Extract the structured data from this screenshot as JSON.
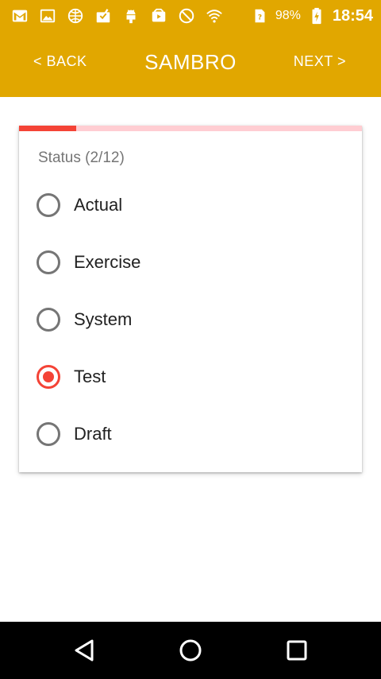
{
  "status_bar": {
    "icons": [
      "gmail-icon",
      "image-icon",
      "globe-icon",
      "mail-check-icon",
      "android-icon",
      "media-icon",
      "do-not-disturb-icon",
      "wifi-icon",
      "sim-card-icon",
      "battery-charging-icon"
    ],
    "battery": "98%",
    "time": "18:54"
  },
  "app_bar": {
    "back_label": "< BACK",
    "title": "SAMBRO",
    "next_label": "NEXT >",
    "color": "#E1A700"
  },
  "question": {
    "label": "Status (2/12)",
    "progress": 0.167,
    "progress_color": "#F44336",
    "progress_track_color": "#FFCDD2",
    "options": [
      {
        "label": "Actual",
        "selected": false
      },
      {
        "label": "Exercise",
        "selected": false
      },
      {
        "label": "System",
        "selected": false
      },
      {
        "label": "Test",
        "selected": true
      },
      {
        "label": "Draft",
        "selected": false
      }
    ]
  },
  "nav_bar": {
    "icons": [
      "back-triangle-icon",
      "home-circle-icon",
      "recents-square-icon"
    ]
  }
}
